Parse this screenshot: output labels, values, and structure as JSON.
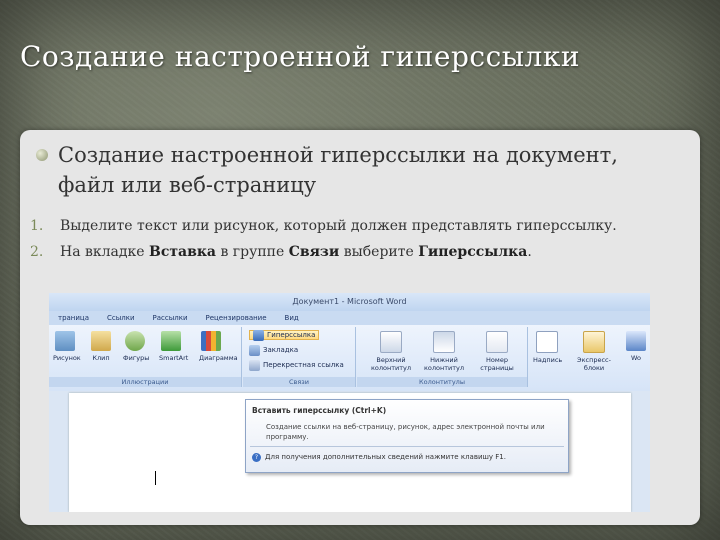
{
  "slide": {
    "title": "Создание настроенной гиперссылки",
    "bullet": "Создание настроенной гиперссылки на документ, файл или веб-страницу",
    "steps": [
      {
        "num": "1.",
        "text": "Выделите текст или рисунок, который должен представлять гиперссылку."
      },
      {
        "num": "2.",
        "pre": "На вкладке ",
        "b1": "Вставка",
        "mid1": " в группе ",
        "b2": "Связи",
        "mid2": " выберите ",
        "b3": "Гиперссылка",
        "post": "."
      }
    ]
  },
  "word": {
    "window_title": "Документ1 - Microsoft Word",
    "tabs": [
      "траница",
      "Ссылки",
      "Рассылки",
      "Рецензирование",
      "Вид"
    ],
    "illustrations": {
      "buttons": [
        "Рисунок",
        "Клип",
        "Фигуры",
        "SmartArt",
        "Диаграмма"
      ],
      "label": "Иллюстрации"
    },
    "links": {
      "items": [
        "Гиперссылка",
        "Закладка",
        "Перекрестная ссылка"
      ],
      "label": "Связи"
    },
    "headers": {
      "buttons": [
        "Верхний колонтитул",
        "Нижний колонтитул",
        "Номер страницы"
      ],
      "label": "Колонтитулы"
    },
    "text_group": {
      "buttons": [
        "Надпись",
        "Экспресс-блоки",
        "Wo"
      ]
    },
    "tooltip": {
      "heading": "Вставить гиперссылку (Ctrl+K)",
      "body": "Создание ссылки на веб-страницу, рисунок, адрес электронной почты или программу.",
      "footer": "Для получения дополнительных сведений нажмите клавишу F1."
    }
  },
  "colors": {
    "background": "#6b7160",
    "panel": "#e6e6e6",
    "accent": "#7b8a5a",
    "ribbon": "#d6e4f7"
  }
}
